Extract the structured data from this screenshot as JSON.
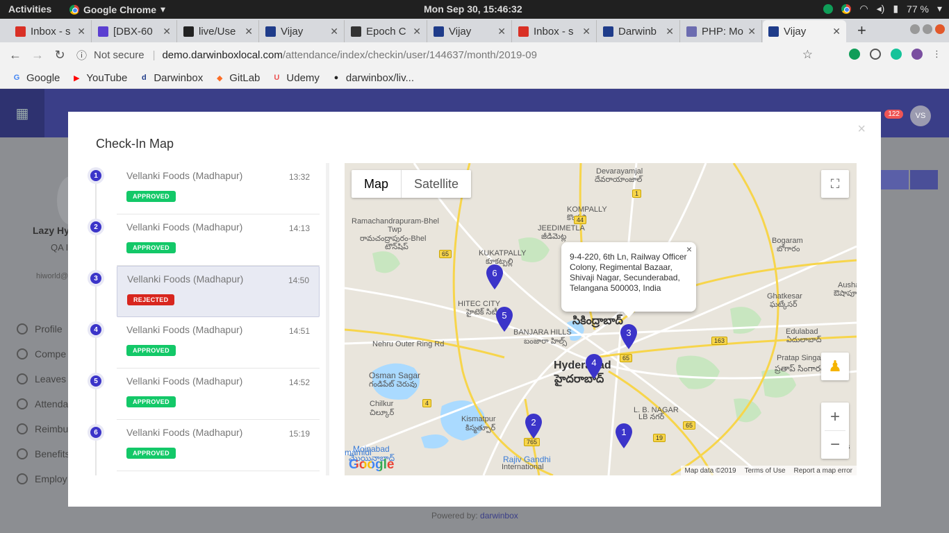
{
  "os": {
    "activities": "Activities",
    "app": "Google Chrome",
    "clock": "Mon Sep 30, 15:46:32",
    "battery": "77 %"
  },
  "tabs": [
    {
      "title": "Inbox - s",
      "icon": "gmail-icon",
      "color": "#d93025"
    },
    {
      "title": "[DBX-60",
      "icon": "jira-icon",
      "color": "#5b3fd1"
    },
    {
      "title": "live/Use",
      "icon": "github-icon",
      "color": "#222222"
    },
    {
      "title": "Vijay",
      "icon": "darwinbox-icon",
      "color": "#1f3c8a"
    },
    {
      "title": "Epoch C",
      "icon": "epoch-icon",
      "color": "#333333"
    },
    {
      "title": "Vijay",
      "icon": "darwinbox-icon",
      "color": "#1f3c8a"
    },
    {
      "title": "Inbox - s",
      "icon": "gmail-icon",
      "color": "#d93025"
    },
    {
      "title": "Darwinb",
      "icon": "darwinbox-icon",
      "color": "#1f3c8a"
    },
    {
      "title": "PHP: Mo",
      "icon": "php-icon",
      "color": "#6c6cb0"
    },
    {
      "title": "Vijay",
      "icon": "darwinbox-icon",
      "color": "#1f3c8a"
    }
  ],
  "address": {
    "security": "Not secure",
    "host": "demo.darwinboxlocal.com",
    "path": "/attendance/index/checkin/user/144637/month/2019-09"
  },
  "bookmarks": [
    {
      "label": "Google",
      "icon": "google-icon"
    },
    {
      "label": "YouTube",
      "icon": "youtube-icon"
    },
    {
      "label": "Darwinbox",
      "icon": "darwinbox-icon"
    },
    {
      "label": "GitLab",
      "icon": "gitlab-icon"
    },
    {
      "label": "Udemy",
      "icon": "udemy-icon"
    },
    {
      "label": "darwinbox/liv...",
      "icon": "github-icon"
    }
  ],
  "background": {
    "badge": "122",
    "avatar": "VS",
    "name": "Lazy Hy",
    "role": "QA I",
    "email": "hiworld@",
    "nav": [
      "Profile",
      "Compe",
      "Leaves",
      "Attenda",
      "Reimbu",
      "Benefits",
      "Employ"
    ],
    "powered_prefix": "Powered by: ",
    "powered_brand": "darwinbox"
  },
  "modal": {
    "title": "Check-In Map",
    "close": "×",
    "checkins": [
      {
        "num": "1",
        "location": "Vellanki Foods (Madhapur)",
        "time": "13:32",
        "status": "APPROVED",
        "selected": false
      },
      {
        "num": "2",
        "location": "Vellanki Foods (Madhapur)",
        "time": "14:13",
        "status": "APPROVED",
        "selected": false
      },
      {
        "num": "3",
        "location": "Vellanki Foods (Madhapur)",
        "time": "14:50",
        "status": "REJECTED",
        "selected": true
      },
      {
        "num": "4",
        "location": "Vellanki Foods (Madhapur)",
        "time": "14:51",
        "status": "APPROVED",
        "selected": false
      },
      {
        "num": "5",
        "location": "Vellanki Foods (Madhapur)",
        "time": "14:52",
        "status": "APPROVED",
        "selected": false
      },
      {
        "num": "6",
        "location": "Vellanki Foods (Madhapur)",
        "time": "15:19",
        "status": "APPROVED",
        "selected": false
      }
    ]
  },
  "map": {
    "type_map": "Map",
    "type_satellite": "Satellite",
    "info": "9-4-220, 6th Ln, Railway Officer Colony, Regimental Bazaar, Shivaji Nagar, Secunderabad, Telangana 500003, India",
    "info_close": "×",
    "zoom_in": "+",
    "zoom_out": "−",
    "footer": {
      "data": "Map data ©2019",
      "terms": "Terms of Use",
      "report": "Report a map error"
    },
    "google": "Google",
    "labels": [
      "Devarayamjal",
      "దేవరాయాంజాల్",
      "KOMPALLY",
      "కొంపల్లి",
      "Ramachandrapuram-Bhel",
      "Twp",
      "రామచంద్రాపురం-Bhel",
      "టౌన్‌షిప్",
      "JEEDIMETLA",
      "జీడిమెట్ల",
      "KUKATPALLY",
      "కూకట్పల్లి",
      "Bogaram",
      "బోగారం",
      "Ghatkesar",
      "ఘట్కేసర్",
      "Aushapur",
      "ఔషాపూర్",
      "HITEC CITY",
      "హైటెక్ సిటీ",
      "BANJARA HILLS",
      "బంజారా హిల్స్",
      "సికింద్రాబాద్",
      "Edulabad",
      "ఏదులాబాద్",
      "Nehru Outer Ring Rd",
      "Hyderabad",
      "హైదరాబాద్",
      "Pratap Singaram",
      "ప్రతాప్ సింగారం",
      "Osman Sagar",
      "గండిపేట్ చెరువు",
      "Chilkur",
      "చిల్కూర్",
      "L. B. NAGAR",
      "LB నగర్",
      "Kismatpur",
      "కిస్మత్పూర్",
      "Moinabad",
      "మొయినాబాద్",
      "mamidi",
      "Rajiv Gandhi",
      "International",
      "Des"
    ],
    "road_shields": [
      "1",
      "44",
      "65",
      "163",
      "65",
      "4",
      "765",
      "19",
      "65"
    ],
    "pins": [
      "1",
      "2",
      "3",
      "4",
      "5",
      "6"
    ]
  },
  "colors": {
    "accent": "#3b34c9",
    "approved": "#13c868",
    "rejected": "#d8261e",
    "header": "#3a3e88"
  }
}
